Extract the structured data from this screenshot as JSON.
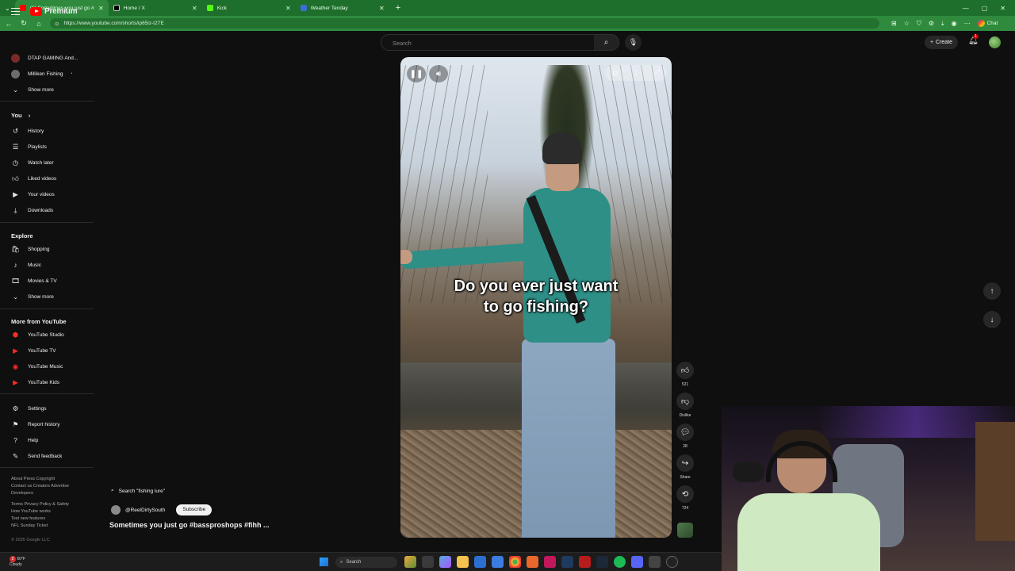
{
  "browser": {
    "tabs": [
      {
        "label": "(1) Sometimes you just go #b",
        "color": "#ff0000",
        "active": true
      },
      {
        "label": "Home / X",
        "color": "#000000",
        "active": false
      },
      {
        "label": "Kick",
        "color": "#53fc18",
        "active": false
      },
      {
        "label": "Weather Tenday",
        "color": "#3b6fd6",
        "active": false
      }
    ],
    "url": "https://www.youtube.com/shorts/ip65iz-I2TE",
    "chat_label": "Chat"
  },
  "header": {
    "logo_text": "Premium",
    "search_placeholder": "Search",
    "create_label": "Create",
    "notif_count": "1"
  },
  "sidebar": {
    "subscriptions": [
      {
        "label": "DTAP GAMING And..."
      },
      {
        "label": "Milliken Fishing"
      }
    ],
    "show_more_1": "Show more",
    "you_heading": "You",
    "you_items": [
      {
        "label": "History",
        "icon": "history-icon"
      },
      {
        "label": "Playlists",
        "icon": "playlists-icon"
      },
      {
        "label": "Watch later",
        "icon": "watch-later-icon"
      },
      {
        "label": "Liked videos",
        "icon": "liked-videos-icon"
      },
      {
        "label": "Your videos",
        "icon": "your-videos-icon"
      },
      {
        "label": "Downloads",
        "icon": "downloads-icon"
      }
    ],
    "explore_heading": "Explore",
    "explore_items": [
      {
        "label": "Shopping"
      },
      {
        "label": "Music"
      },
      {
        "label": "Movies & TV"
      }
    ],
    "show_more_2": "Show more",
    "more_heading": "More from YouTube",
    "more_items": [
      {
        "label": "YouTube Studio"
      },
      {
        "label": "YouTube TV"
      },
      {
        "label": "YouTube Music"
      },
      {
        "label": "YouTube Kids"
      }
    ],
    "settings_items": [
      {
        "label": "Settings"
      },
      {
        "label": "Report history"
      },
      {
        "label": "Help"
      },
      {
        "label": "Send feedback"
      }
    ],
    "footer": {
      "line1": "About  Press  Copyright",
      "line2": "Contact us  Creators  Advertise",
      "line3": "Developers",
      "line4": "Terms  Privacy  Policy & Safety",
      "line5": "How YouTube works",
      "line6": "Test new features",
      "line7": "NFL Sunday Ticket",
      "copyright": "© 2025 Google LLC"
    }
  },
  "short": {
    "caption_line1": "Do you ever just want",
    "caption_line2": "to go fishing?",
    "search_chip": "Search \"fishing lure\"",
    "channel": "@ReelDirtySouth",
    "subscribe_label": "Subscribe",
    "title": "Sometimes you just go #bassproshops #fihh ..."
  },
  "actions": {
    "likes": "521",
    "dislike_label": "Dislike",
    "comments": "28",
    "share_label": "Share",
    "remix": "724"
  },
  "taskbar": {
    "temp": "60°F",
    "weather": "Cloudy",
    "weather_badge": "2",
    "search_label": "Search"
  }
}
